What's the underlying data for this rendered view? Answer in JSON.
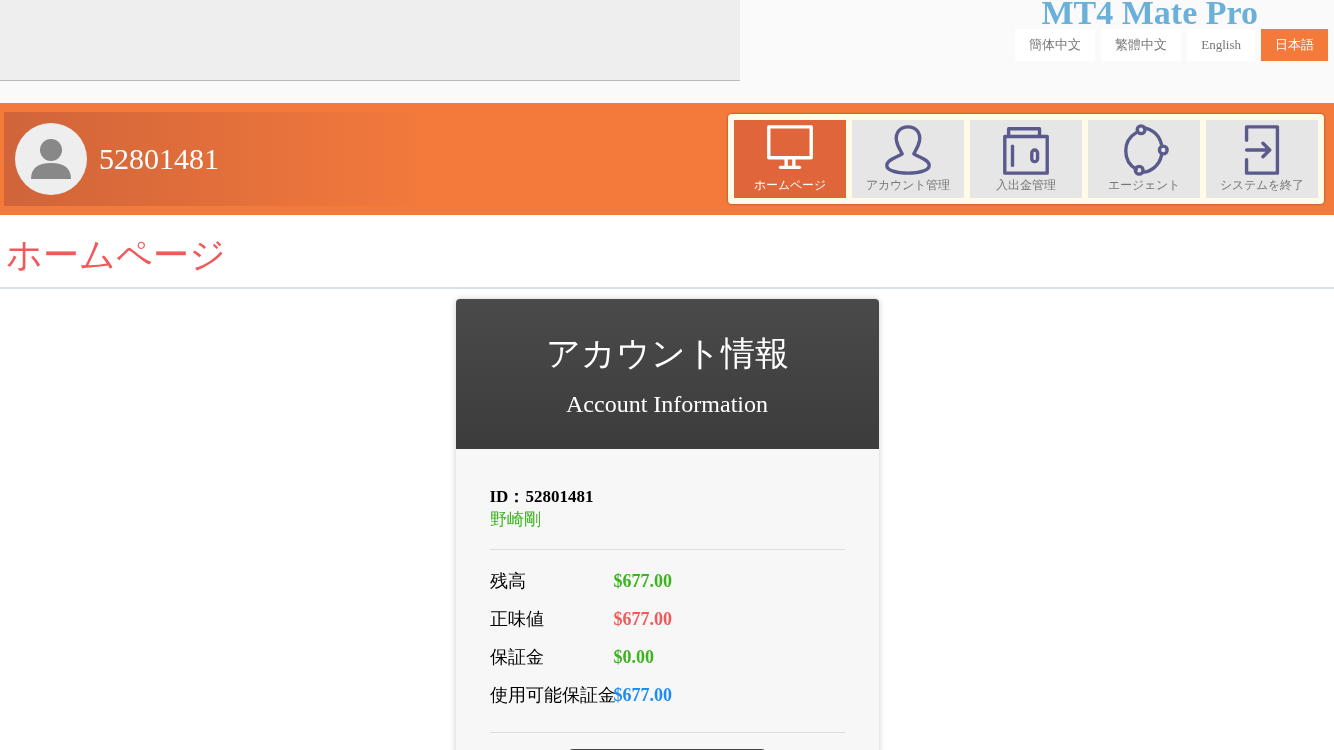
{
  "brand": "MT4 Mate Pro",
  "languages": [
    {
      "label": "簡体中文",
      "selected": false
    },
    {
      "label": "繁體中文",
      "selected": false
    },
    {
      "label": "English",
      "selected": false
    },
    {
      "label": "日本語",
      "selected": true
    }
  ],
  "user": {
    "account": "52801481"
  },
  "nav": [
    {
      "label": "ホームページ",
      "kind": "monitor",
      "selected": true
    },
    {
      "label": "アカウント管理",
      "kind": "person",
      "selected": false
    },
    {
      "label": "入出金管理",
      "kind": "wallet",
      "selected": false
    },
    {
      "label": "エージェント",
      "kind": "network",
      "selected": false
    },
    {
      "label": "システムを終了",
      "kind": "exit",
      "selected": false
    }
  ],
  "page_title": "ホームページ",
  "card": {
    "title": "アカウント情報",
    "subtitle": "Account Information",
    "id_line": "ID：52801481",
    "name": "野崎剛",
    "rows": [
      {
        "label": "残高",
        "value": "$677.00",
        "color": "#3cb41e"
      },
      {
        "label": "正味値",
        "value": "$677.00",
        "color": "#f05a5a"
      },
      {
        "label": "保証金",
        "value": "$0.00",
        "color": "#3cb41e"
      },
      {
        "label": "使用可能保証金",
        "value": "$677.00",
        "color": "#1e8cf0"
      }
    ]
  }
}
